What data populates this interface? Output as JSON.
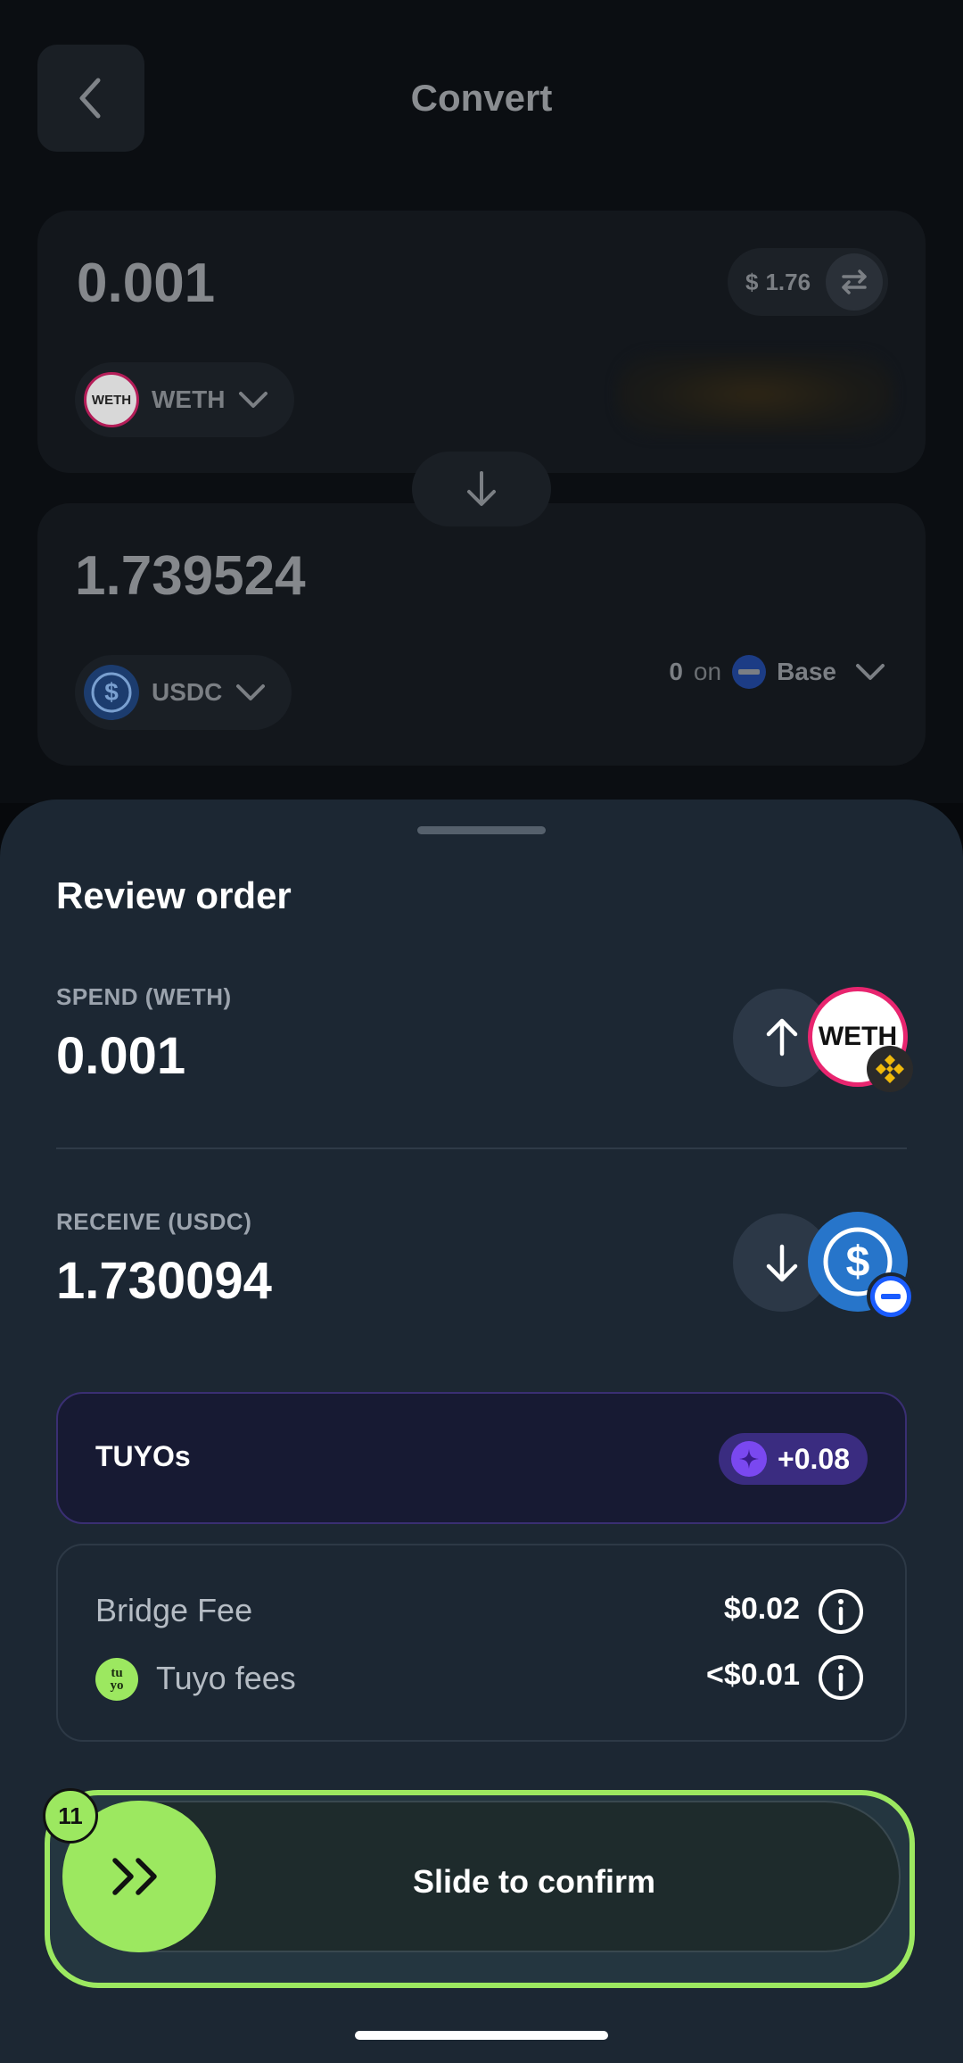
{
  "header": {
    "title": "Convert"
  },
  "from": {
    "amount": "0.001",
    "usd_symbol": "$",
    "usd_value": "1.76",
    "token": "WETH",
    "token_icon_text": "WETH"
  },
  "to": {
    "amount": "1.739524",
    "token": "USDC",
    "balance": "0",
    "on": "on",
    "network": "Base"
  },
  "review": {
    "title": "Review order",
    "spend_label": "SPEND (WETH)",
    "spend_amount": "0.001",
    "spend_coin_text": "WETH",
    "receive_label": "RECEIVE (USDC)",
    "receive_amount": "1.730094"
  },
  "rewards": {
    "label": "TUYOs",
    "value": "+0.08"
  },
  "fees": [
    {
      "label": "Bridge Fee",
      "value": "$0.02"
    },
    {
      "label": "Tuyo fees",
      "value": "<$0.01",
      "icon_text": "tu yo"
    }
  ],
  "confirm": {
    "label": "Slide to confirm",
    "step": "11"
  },
  "colors": {
    "accent_green": "#9ce860",
    "sheet_bg": "#1c2733",
    "tuyo_purple": "#3a2c80",
    "usdc_blue": "#2775ca",
    "weth_pink": "#e8256f"
  }
}
